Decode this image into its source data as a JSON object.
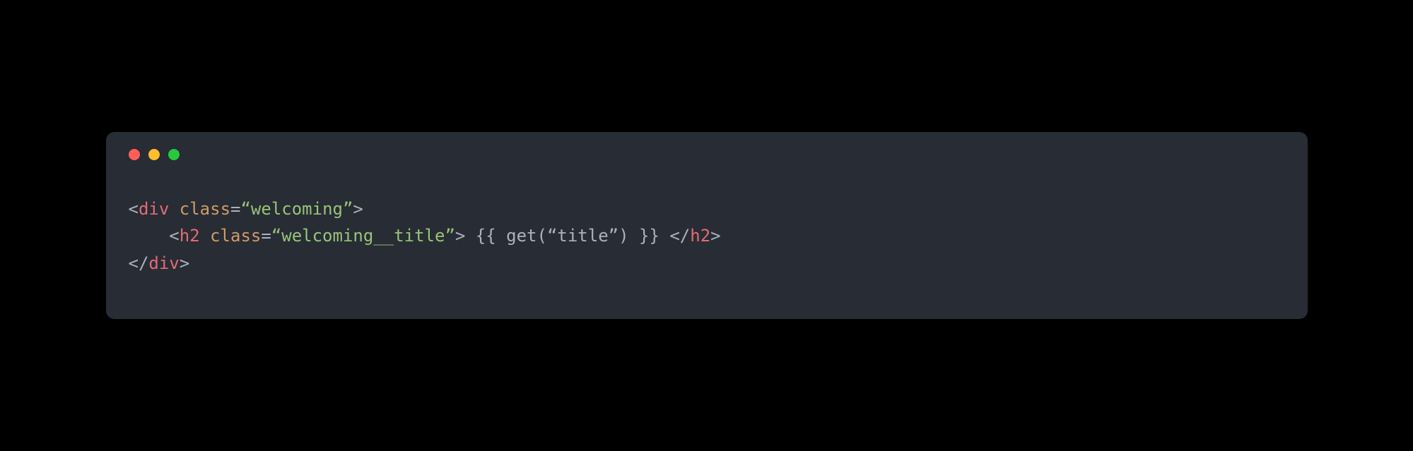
{
  "window": {
    "controls": {
      "close": "close",
      "minimize": "minimize",
      "maximize": "maximize"
    }
  },
  "code": {
    "line1": {
      "open_bracket": "<",
      "tag": "div",
      "space": " ",
      "attr": "class",
      "eq": "=",
      "val": "“welcoming”",
      "close_bracket": ">"
    },
    "line2": {
      "indent": "    ",
      "open_bracket": "<",
      "tag": "h2",
      "space": " ",
      "attr": "class",
      "eq": "=",
      "val": "“welcoming__title”",
      "close_bracket": ">",
      "content": " {{ get(“title”) }} ",
      "close_open": "</",
      "close_tag": "h2",
      "close_end": ">"
    },
    "line3": {
      "close_open": "</",
      "tag": "div",
      "close_bracket": ">"
    }
  }
}
